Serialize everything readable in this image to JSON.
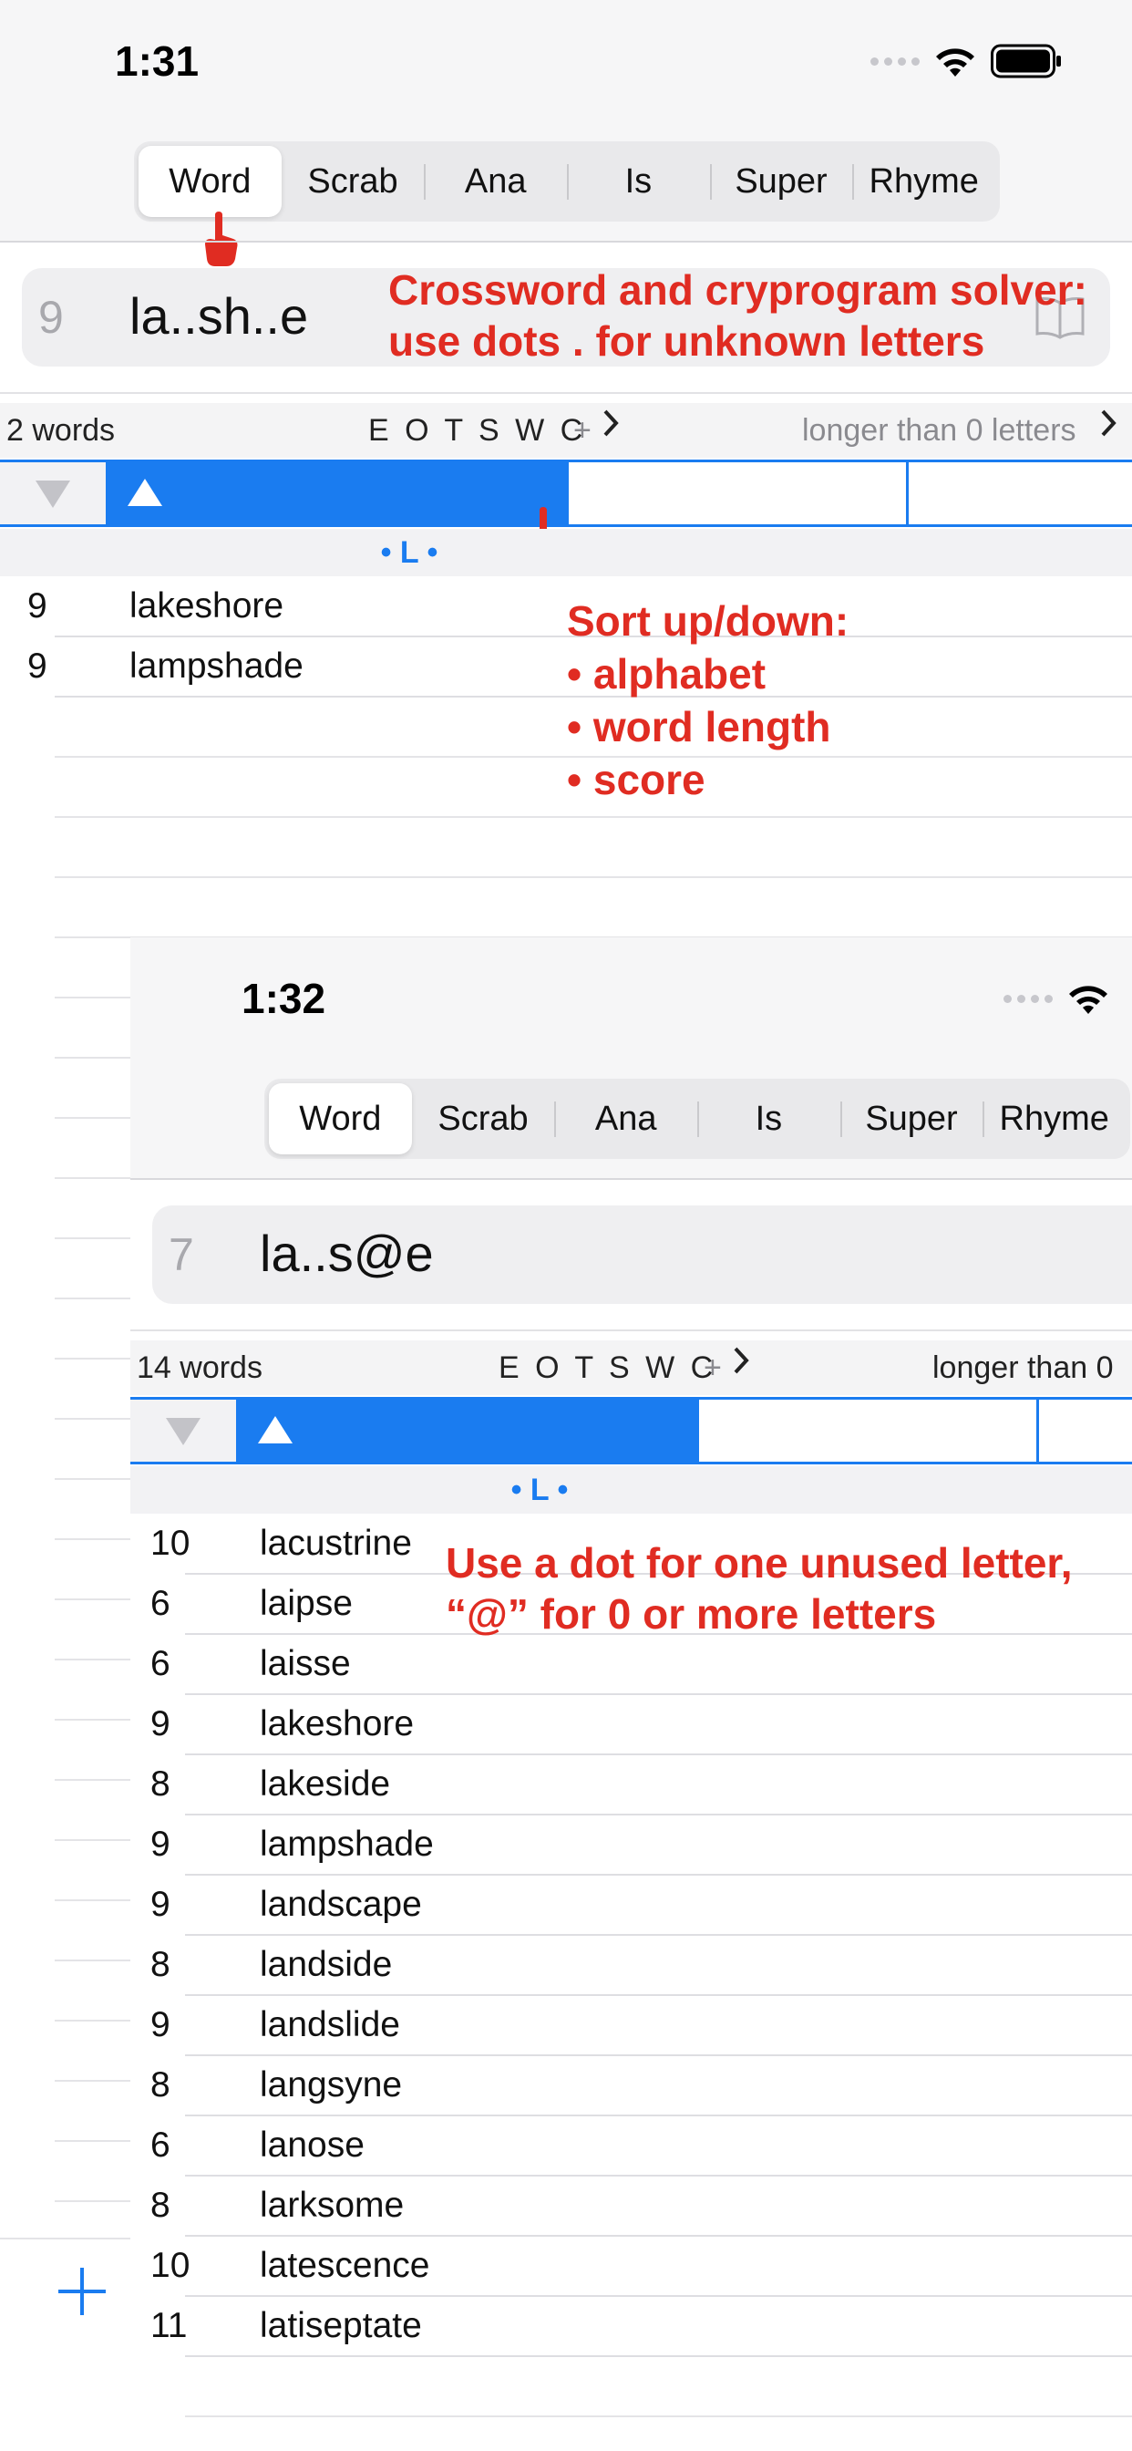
{
  "screen1": {
    "time": "1:31",
    "tabs": [
      "Word",
      "Scrab",
      "Ana",
      "Is",
      "Super",
      "Rhyme"
    ],
    "selected_tab": "Word",
    "search": {
      "length": "9",
      "query": "la..sh..e"
    },
    "info": {
      "count": "2 words",
      "letters": "E O T S W C",
      "plus": "+",
      "longer": "longer than 0 letters"
    },
    "index_label": "• L •",
    "rows": [
      {
        "num": "9",
        "word": "lakeshore"
      },
      {
        "num": "9",
        "word": "lampshade"
      }
    ],
    "annotation_top": [
      "Crossword and cryprogram solver:",
      "use dots . for unknown letters"
    ],
    "annotation_sort": [
      "Sort up/down:",
      "• alphabet",
      "• word length",
      "• score"
    ]
  },
  "screen2": {
    "time": "1:32",
    "tabs": [
      "Word",
      "Scrab",
      "Ana",
      "Is",
      "Super",
      "Rhyme"
    ],
    "selected_tab": "Word",
    "search": {
      "length": "7",
      "query": "la..s@e"
    },
    "info": {
      "count": "14 words",
      "letters": "E O T S W C",
      "plus": "+",
      "longer": "longer than 0"
    },
    "index_label": "• L •",
    "rows": [
      {
        "num": "10",
        "word": "lacustrine"
      },
      {
        "num": "6",
        "word": "laipse"
      },
      {
        "num": "6",
        "word": "laisse"
      },
      {
        "num": "9",
        "word": "lakeshore"
      },
      {
        "num": "8",
        "word": "lakeside"
      },
      {
        "num": "9",
        "word": "lampshade"
      },
      {
        "num": "9",
        "word": "landscape"
      },
      {
        "num": "8",
        "word": "landside"
      },
      {
        "num": "9",
        "word": "landslide"
      },
      {
        "num": "8",
        "word": "langsyne"
      },
      {
        "num": "6",
        "word": "lanose"
      },
      {
        "num": "8",
        "word": "larksome"
      },
      {
        "num": "10",
        "word": "latescence"
      },
      {
        "num": "11",
        "word": "latiseptate"
      }
    ],
    "annotation": [
      "Use a dot for one unused letter,",
      "“@” for 0 or more letters"
    ]
  },
  "colors": {
    "accent": "#1a7cf0",
    "annotation": "#e02c22"
  }
}
